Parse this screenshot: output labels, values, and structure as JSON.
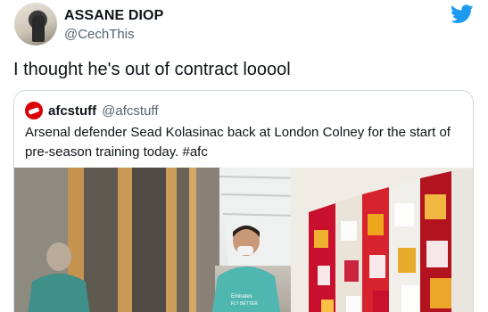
{
  "tweet": {
    "author_name": "ASSANE DIOP",
    "author_handle": "@CechThis",
    "text": "I thought he's out of contract looool"
  },
  "quoted": {
    "author_name": "afcstuff",
    "author_handle": "@afcstuff",
    "text": "Arsenal defender Sead Kolasinac back at London Colney for the start of pre-season training today. #afc",
    "image_shirt_text": "Emirates FLY BETTER"
  },
  "colors": {
    "twitter_blue": "#1d9bf0",
    "arsenal_red": "#db0007",
    "secondary_text": "#536471",
    "border": "#cfd9de"
  },
  "icons": {
    "twitter": "twitter-bird-icon"
  }
}
